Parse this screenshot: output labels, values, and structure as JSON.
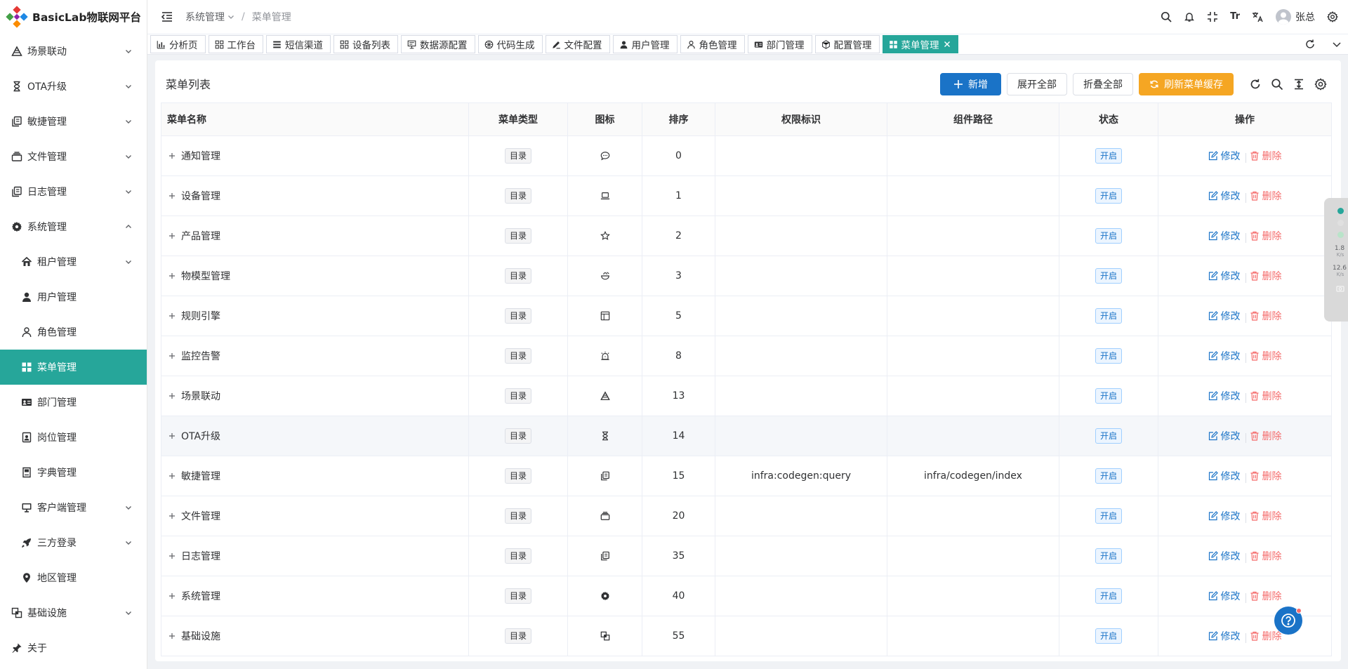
{
  "app": {
    "title": "BasicLab物联网平台"
  },
  "sidebar": {
    "items": [
      {
        "label": "场景联动",
        "icon": "scene-icon",
        "expandable": true
      },
      {
        "label": "OTA升级",
        "icon": "hourglass-icon",
        "expandable": true
      },
      {
        "label": "敏捷管理",
        "icon": "copy-icon",
        "expandable": true
      },
      {
        "label": "文件管理",
        "icon": "stack-icon",
        "expandable": true
      },
      {
        "label": "日志管理",
        "icon": "copy-icon",
        "expandable": true
      },
      {
        "label": "系统管理",
        "icon": "gear-icon",
        "expandable": true,
        "expanded": true
      },
      {
        "label": "租户管理",
        "icon": "house-icon",
        "expandable": true,
        "sub": true
      },
      {
        "label": "用户管理",
        "icon": "user-icon",
        "sub": true
      },
      {
        "label": "角色管理",
        "icon": "user-outline-icon",
        "sub": true
      },
      {
        "label": "菜单管理",
        "icon": "grid-icon",
        "sub": true,
        "active": true
      },
      {
        "label": "部门管理",
        "icon": "id-card-icon",
        "sub": true
      },
      {
        "label": "岗位管理",
        "icon": "badge-icon",
        "sub": true
      },
      {
        "label": "字典管理",
        "icon": "book-icon",
        "sub": true
      },
      {
        "label": "客户端管理",
        "icon": "monitor-icon",
        "expandable": true,
        "sub": true
      },
      {
        "label": "三方登录",
        "icon": "rocket-icon",
        "expandable": true,
        "sub": true
      },
      {
        "label": "地区管理",
        "icon": "location-icon",
        "sub": true
      },
      {
        "label": "基础设施",
        "icon": "layers-icon",
        "expandable": true
      },
      {
        "label": "关于",
        "icon": "pin-icon"
      }
    ]
  },
  "header": {
    "breadcrumb": [
      "系统管理",
      "菜单管理"
    ],
    "user_name": "张总",
    "font_icon_text": "Tr"
  },
  "tabs": [
    {
      "label": "分析页",
      "icon": "chart-icon"
    },
    {
      "label": "工作台",
      "icon": "grid-outline-icon"
    },
    {
      "label": "短信渠道",
      "icon": "list-icon"
    },
    {
      "label": "设备列表",
      "icon": "grid-outline-icon"
    },
    {
      "label": "数据源配置",
      "icon": "datasource-icon"
    },
    {
      "label": "代码生成",
      "icon": "code-icon"
    },
    {
      "label": "文件配置",
      "icon": "edit-icon"
    },
    {
      "label": "用户管理",
      "icon": "user-icon"
    },
    {
      "label": "角色管理",
      "icon": "user-outline-icon"
    },
    {
      "label": "部门管理",
      "icon": "id-card-icon"
    },
    {
      "label": "配置管理",
      "icon": "config-icon"
    },
    {
      "label": "菜单管理",
      "icon": "grid-icon",
      "active": true
    }
  ],
  "page": {
    "title": "菜单列表",
    "buttons": {
      "add": "新增",
      "expand_all": "展开全部",
      "collapse_all": "折叠全部",
      "refresh_cache": "刷新菜单缓存"
    }
  },
  "table": {
    "columns": [
      "菜单名称",
      "菜单类型",
      "图标",
      "排序",
      "权限标识",
      "组件路径",
      "状态",
      "操作"
    ],
    "edit_label": "修改",
    "delete_label": "删除",
    "rows": [
      {
        "name": "通知管理",
        "type": "目录",
        "icon": "chat-icon",
        "sort": "0",
        "permission": "",
        "component": "",
        "status": "开启"
      },
      {
        "name": "设备管理",
        "type": "目录",
        "icon": "laptop-icon",
        "sort": "1",
        "permission": "",
        "component": "",
        "status": "开启"
      },
      {
        "name": "产品管理",
        "type": "目录",
        "icon": "star-icon",
        "sort": "2",
        "permission": "",
        "component": "",
        "status": "开启"
      },
      {
        "name": "物模型管理",
        "type": "目录",
        "icon": "bowl-icon",
        "sort": "3",
        "permission": "",
        "component": "",
        "status": "开启"
      },
      {
        "name": "规则引擎",
        "type": "目录",
        "icon": "layout-icon",
        "sort": "5",
        "permission": "",
        "component": "",
        "status": "开启"
      },
      {
        "name": "监控告警",
        "type": "目录",
        "icon": "alarm-icon",
        "sort": "8",
        "permission": "",
        "component": "",
        "status": "开启"
      },
      {
        "name": "场景联动",
        "type": "目录",
        "icon": "scene-icon",
        "sort": "13",
        "permission": "",
        "component": "",
        "status": "开启"
      },
      {
        "name": "OTA升级",
        "type": "目录",
        "icon": "hourglass-icon",
        "sort": "14",
        "permission": "",
        "component": "",
        "status": "开启",
        "highlight": true
      },
      {
        "name": "敏捷管理",
        "type": "目录",
        "icon": "copy-icon",
        "sort": "15",
        "permission": "infra:codegen:query",
        "component": "infra/codegen/index",
        "status": "开启"
      },
      {
        "name": "文件管理",
        "type": "目录",
        "icon": "stack-icon",
        "sort": "20",
        "permission": "",
        "component": "",
        "status": "开启"
      },
      {
        "name": "日志管理",
        "type": "目录",
        "icon": "copy-icon",
        "sort": "35",
        "permission": "",
        "component": "",
        "status": "开启"
      },
      {
        "name": "系统管理",
        "type": "目录",
        "icon": "gear-icon",
        "sort": "40",
        "permission": "",
        "component": "",
        "status": "开启"
      },
      {
        "name": "基础设施",
        "type": "目录",
        "icon": "layers-icon",
        "sort": "55",
        "permission": "",
        "component": "",
        "status": "开启"
      }
    ]
  },
  "net_widget": {
    "up_value": "1.8",
    "up_unit": "K/s",
    "down_value": "12.6",
    "down_unit": "K/s"
  },
  "colors": {
    "accent": "#26a69a",
    "primary": "#1a73c7",
    "warning": "#f5a623",
    "danger": "#f56c6c"
  }
}
